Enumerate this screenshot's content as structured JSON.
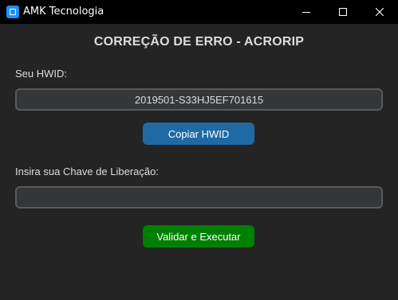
{
  "window": {
    "title": "AMK Tecnologia"
  },
  "heading": "CORREÇÃO DE ERRO - ACRORIP",
  "hwid": {
    "label": "Seu HWID:",
    "value": "2019501-S33HJ5EF701615",
    "copy_button": "Copiar HWID"
  },
  "key": {
    "label": "Insira sua Chave de Liberação:",
    "value": ""
  },
  "validate_button": "Validar e Executar",
  "colors": {
    "background": "#242424",
    "titlebar": "#000000",
    "copy_button": "#1f6aa5",
    "validate_button": "#008000",
    "entry_bg": "#343638",
    "entry_border": "#565b5e"
  },
  "icons": {
    "app": "app-icon",
    "minimize": "minimize-icon",
    "maximize": "maximize-icon",
    "close": "close-icon"
  }
}
